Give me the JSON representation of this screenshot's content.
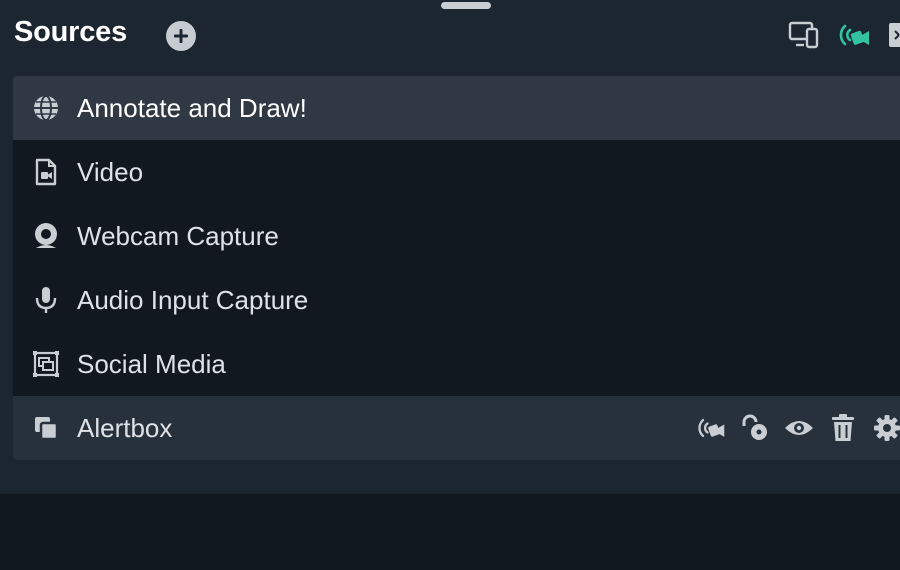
{
  "header": {
    "title": "Sources",
    "add_icon": "plus-circle-icon",
    "icons": [
      "devices-icon",
      "live-camera-icon",
      "collapse-panel-icon"
    ],
    "live_icon_color": "#31c3a2"
  },
  "sources": [
    {
      "label": "Annotate and Draw!",
      "icon": "globe-icon",
      "state": "selected"
    },
    {
      "label": "Video",
      "icon": "video-file-icon",
      "state": "normal"
    },
    {
      "label": "Webcam Capture",
      "icon": "webcam-icon",
      "state": "normal"
    },
    {
      "label": "Audio Input Capture",
      "icon": "microphone-icon",
      "state": "normal"
    },
    {
      "label": "Social Media",
      "icon": "screen-frame-icon",
      "state": "normal"
    },
    {
      "label": "Alertbox",
      "icon": "copy-layers-icon",
      "state": "hovered"
    }
  ],
  "row_actions": [
    "live-camera-icon",
    "unlock-icon",
    "eye-icon",
    "trash-icon",
    "gear-icon"
  ]
}
